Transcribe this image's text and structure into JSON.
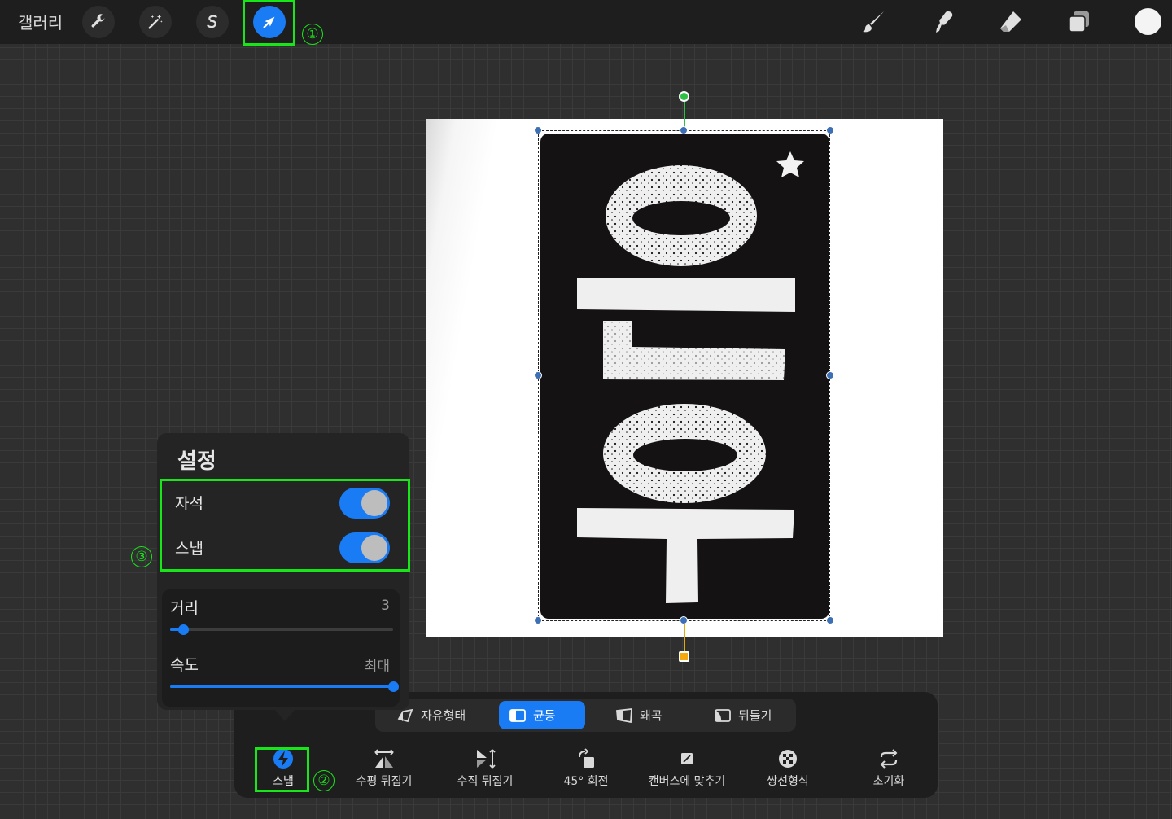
{
  "topbar": {
    "gallery_label": "갤러리",
    "left_tools": [
      "wrench-icon",
      "magic-wand-icon",
      "selection-s-icon",
      "transform-arrow-icon"
    ],
    "right_tools": [
      "brush-icon",
      "smudge-icon",
      "eraser-icon",
      "layers-icon"
    ],
    "current_color": "#f4f4f4"
  },
  "annotations": {
    "marker_1": "①",
    "marker_2": "②",
    "marker_3": "③",
    "highlight_color": "#19e619"
  },
  "settings": {
    "title": "설정",
    "magnet_label": "자석",
    "magnet_on": true,
    "snap_label": "스냅",
    "snap_on": true,
    "distance_label": "거리",
    "distance_value": "3",
    "distance_level": 0.06,
    "speed_label": "속도",
    "speed_value": "최대",
    "speed_level": 1.0
  },
  "modes": {
    "freeform": "자유형태",
    "uniform": "균등",
    "distort": "왜곡",
    "warp": "뒤틀기",
    "active": "uniform"
  },
  "actions": {
    "snap": "스냅",
    "flip_h": "수평 뒤집기",
    "flip_v": "수직 뒤집기",
    "rotate45": "45° 회전",
    "fit_canvas": "캔버스에 맞추기",
    "bilinear": "쌍선형식",
    "reset": "초기화"
  },
  "colors": {
    "accent": "#1a7cf5",
    "rotate_handle": "#2fbf44",
    "warp_handle": "#f5a90c"
  }
}
